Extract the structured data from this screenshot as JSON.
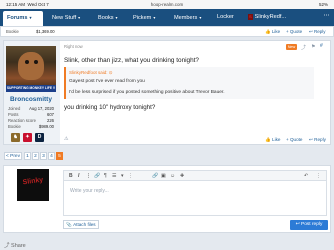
{
  "status_bar": {
    "time": "12:15 AM",
    "day": "Wed Oct 7",
    "url": "hoop-realm.com",
    "battery": "52%"
  },
  "nav": {
    "tabs": [
      "Forums",
      "New Stuff",
      "Books",
      "Pickem",
      "Members",
      "Locker",
      "SlinkyRedf..."
    ],
    "active": "Forums"
  },
  "top_strip": {
    "bookie_label": "Bookie",
    "bookie_value": "$1,369.00",
    "like": "Like",
    "quote": "Quote",
    "reply": "Reply"
  },
  "post": {
    "meta": "Right now",
    "new_badge": "New",
    "avatar_banner": "SUPPORTING MONKEY LIFE !!",
    "username": "Broncosmitty",
    "stats": [
      {
        "label": "Joined",
        "value": "Aug 17, 2020"
      },
      {
        "label": "Posts",
        "value": "607"
      },
      {
        "label": "Reaction score",
        "value": "226"
      },
      {
        "label": "Bookie",
        "value": "$989.00"
      }
    ],
    "trophies": [
      "trophy-1",
      "trophy-2",
      "trophy-3"
    ],
    "message_line1": "Slink, other than jizz, what you drinking tonight?",
    "quote": {
      "author": "SlinkyRedfoot said: ⊙",
      "line1": "Gayest post I've ever read from you",
      "line2": "I'd be less surprised if you posted something positive about Trevor Bauer."
    },
    "message_line2": "you drinking 10\" hydroxy tonight?",
    "actions": {
      "like": "Like",
      "quote": "Quote",
      "reply": "Reply"
    }
  },
  "pagination": {
    "prev": "< Prev",
    "pages": [
      "1",
      "2",
      "3",
      "4",
      "5"
    ],
    "current": "5"
  },
  "reply_box": {
    "avatar_text": "Slinky",
    "placeholder": "Write your reply...",
    "attach": "Attach files",
    "post_reply": "Post reply"
  },
  "share": "Share",
  "colors": {
    "nav": "#1a4f7f",
    "accent": "#f07b24",
    "link": "#1f5f98",
    "button": "#2c7bd6"
  }
}
